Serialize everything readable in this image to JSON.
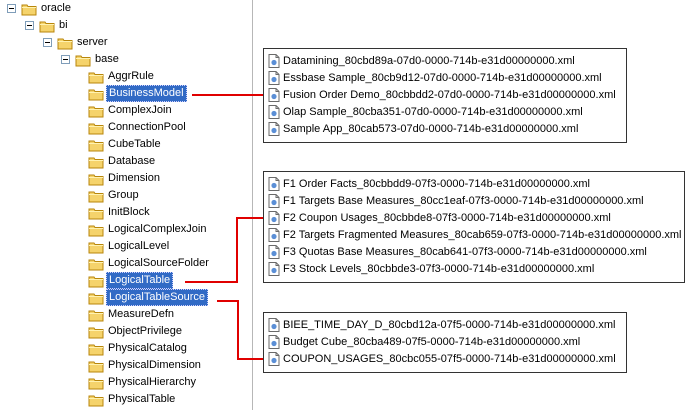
{
  "tree": {
    "items": [
      {
        "label": "oracle",
        "selected": false
      },
      {
        "label": "bi",
        "selected": false
      },
      {
        "label": "server",
        "selected": false
      },
      {
        "label": "base",
        "selected": false
      },
      {
        "label": "AggrRule",
        "selected": false
      },
      {
        "label": "BusinessModel",
        "selected": true
      },
      {
        "label": "ComplexJoin",
        "selected": false
      },
      {
        "label": "ConnectionPool",
        "selected": false
      },
      {
        "label": "CubeTable",
        "selected": false
      },
      {
        "label": "Database",
        "selected": false
      },
      {
        "label": "Dimension",
        "selected": false
      },
      {
        "label": "Group",
        "selected": false
      },
      {
        "label": "InitBlock",
        "selected": false
      },
      {
        "label": "LogicalComplexJoin",
        "selected": false
      },
      {
        "label": "LogicalLevel",
        "selected": false
      },
      {
        "label": "LogicalSourceFolder",
        "selected": false
      },
      {
        "label": "LogicalTable",
        "selected": true
      },
      {
        "label": "LogicalTableSource",
        "selected": true
      },
      {
        "label": "MeasureDefn",
        "selected": false
      },
      {
        "label": "ObjectPrivilege",
        "selected": false
      },
      {
        "label": "PhysicalCatalog",
        "selected": false
      },
      {
        "label": "PhysicalDimension",
        "selected": false
      },
      {
        "label": "PhysicalHierarchy",
        "selected": false
      },
      {
        "label": "PhysicalTable",
        "selected": false
      }
    ]
  },
  "file_groups": [
    {
      "files": [
        "Datamining_80cbd89a-07d0-0000-714b-e31d00000000.xml",
        "Essbase Sample_80cb9d12-07d0-0000-714b-e31d00000000.xml",
        "Fusion Order Demo_80cbbdd2-07d0-0000-714b-e31d00000000.xml",
        "Olap Sample_80cba351-07d0-0000-714b-e31d00000000.xml",
        "Sample App_80cab573-07d0-0000-714b-e31d00000000.xml"
      ],
      "highlighted": 2
    },
    {
      "files": [
        "F1 Order Facts_80cbbdd9-07f3-0000-714b-e31d00000000.xml",
        "F1 Targets Base Measures_80cc1eaf-07f3-0000-714b-e31d00000000.xml",
        "F2 Coupon Usages_80cbbde8-07f3-0000-714b-e31d00000000.xml",
        "F2 Targets Fragmented Measures_80cab659-07f3-0000-714b-e31d00000000.xml",
        "F3 Quotas Base Measures_80cab641-07f3-0000-714b-e31d00000000.xml",
        "F3 Stock Levels_80cbbde3-07f3-0000-714b-e31d00000000.xml"
      ],
      "highlighted": 2
    },
    {
      "files": [
        "BIEE_TIME_DAY_D_80cbd12a-07f5-0000-714b-e31d00000000.xml",
        "Budget Cube_80cba489-07f5-0000-714b-e31d00000000.xml",
        "COUPON_USAGES_80cbc055-07f5-0000-714b-e31d00000000.xml"
      ],
      "highlighted": 2
    }
  ],
  "colors": {
    "highlight": "#e00000",
    "selection": "#316ac5",
    "folder": "#f2c84b"
  },
  "icons": {
    "folder": "folder-icon",
    "file": "xml-file-icon",
    "expander": "collapse-icon"
  }
}
